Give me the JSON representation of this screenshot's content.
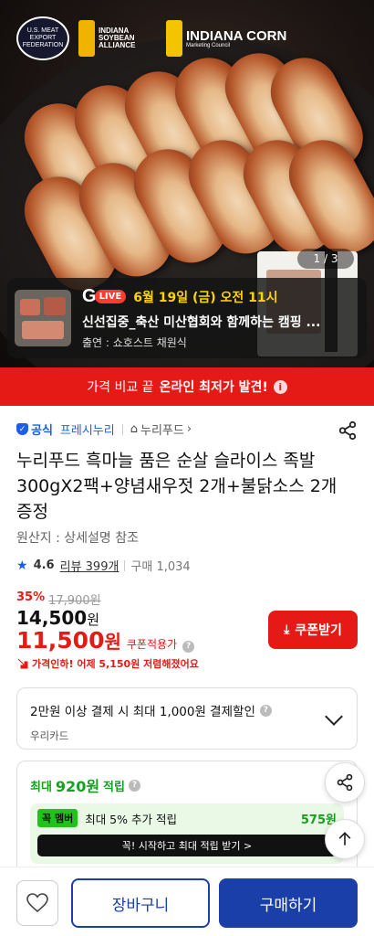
{
  "hero": {
    "counter": "1 / 3",
    "logos": {
      "usmef": "U.S. MEAT EXPORT FEDERATION",
      "soybean": "INDIANA SOYBEAN ALLIANCE",
      "corn_title": "INDIANA CORN",
      "corn_sub": "Marketing Council"
    }
  },
  "live_banner": {
    "brand_letter": "G",
    "live_label": "LIVE",
    "date": "6월 19일 (금) 오전 11시",
    "title": "신선집중_축산 미산협회와 함께하는 캠핑 ...",
    "host": "출연 : 쇼호스트 채원식"
  },
  "promo_banner": {
    "prefix": "가격 비교 끝",
    "highlight": "온라인 최저가 발견!"
  },
  "breadcrumb": {
    "official": "공식",
    "seller": "프레시누리",
    "store": "누리푸드"
  },
  "product": {
    "title": "누리푸드 흑마늘 품은 순살 슬라이스 족발 300gX2팩+양념새우젓 2개+불닭소스 2개 증정",
    "origin": "원산지 : 상세설명 참조",
    "rating": "4.6",
    "reviews": "리뷰 399개",
    "purchases": "구매 1,034",
    "discount_rate": "35%",
    "original_price": "17,900원",
    "price_amount": "14,500",
    "price_unit": "원",
    "coupon_amount": "11,500",
    "coupon_unit": "원",
    "coupon_label": "쿠폰적용가",
    "price_drop": "가격인하! 어제 5,150원 저렴해졌어요",
    "coupon_button": "쿠폰받기"
  },
  "card_benefit": {
    "main": "2만원 이상 결제 시 최대 1,000원 결제할인",
    "card": "우리카드"
  },
  "points": {
    "prefix": "최대",
    "amount": "920원",
    "suffix": "적립",
    "member_badge": "꼭 멤버",
    "member_text": "최대 5% 추가 적립",
    "member_points": "575원",
    "member_cta": "꼭! 시작하고 최대 적립 받기 >"
  },
  "bottom_bar": {
    "cart": "장바구니",
    "buy": "구매하기"
  },
  "colors": {
    "accent_red": "#e51a16",
    "brand_blue": "#1a3fa8",
    "point_green": "#16a01f"
  }
}
